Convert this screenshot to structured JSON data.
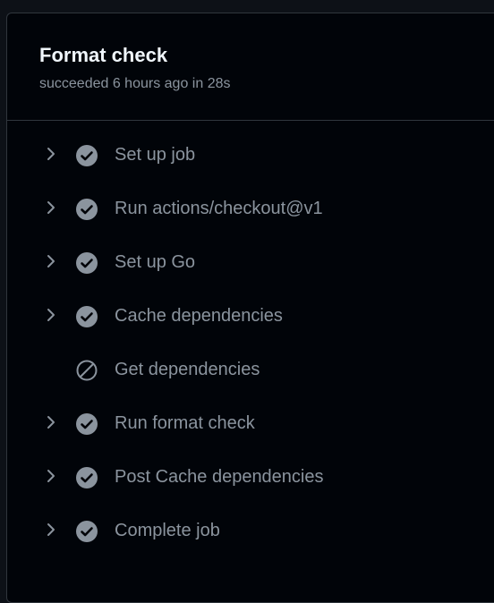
{
  "job": {
    "title": "Format check",
    "summary": "succeeded 6 hours ago in 28s"
  },
  "steps": [
    {
      "label": "Set up job",
      "status": "success",
      "expandable": true
    },
    {
      "label": "Run actions/checkout@v1",
      "status": "success",
      "expandable": true
    },
    {
      "label": "Set up Go",
      "status": "success",
      "expandable": true
    },
    {
      "label": "Cache dependencies",
      "status": "success",
      "expandable": true
    },
    {
      "label": "Get dependencies",
      "status": "skipped",
      "expandable": false
    },
    {
      "label": "Run format check",
      "status": "success",
      "expandable": true
    },
    {
      "label": "Post Cache dependencies",
      "status": "success",
      "expandable": true
    },
    {
      "label": "Complete job",
      "status": "success",
      "expandable": true
    }
  ],
  "icons": {
    "expand": "chevron-right-icon",
    "success": "check-circle-fill-icon",
    "skipped": "skip-icon"
  },
  "colors": {
    "background": "#010409",
    "title": "#f0f6fc",
    "muted": "#8b949e"
  }
}
